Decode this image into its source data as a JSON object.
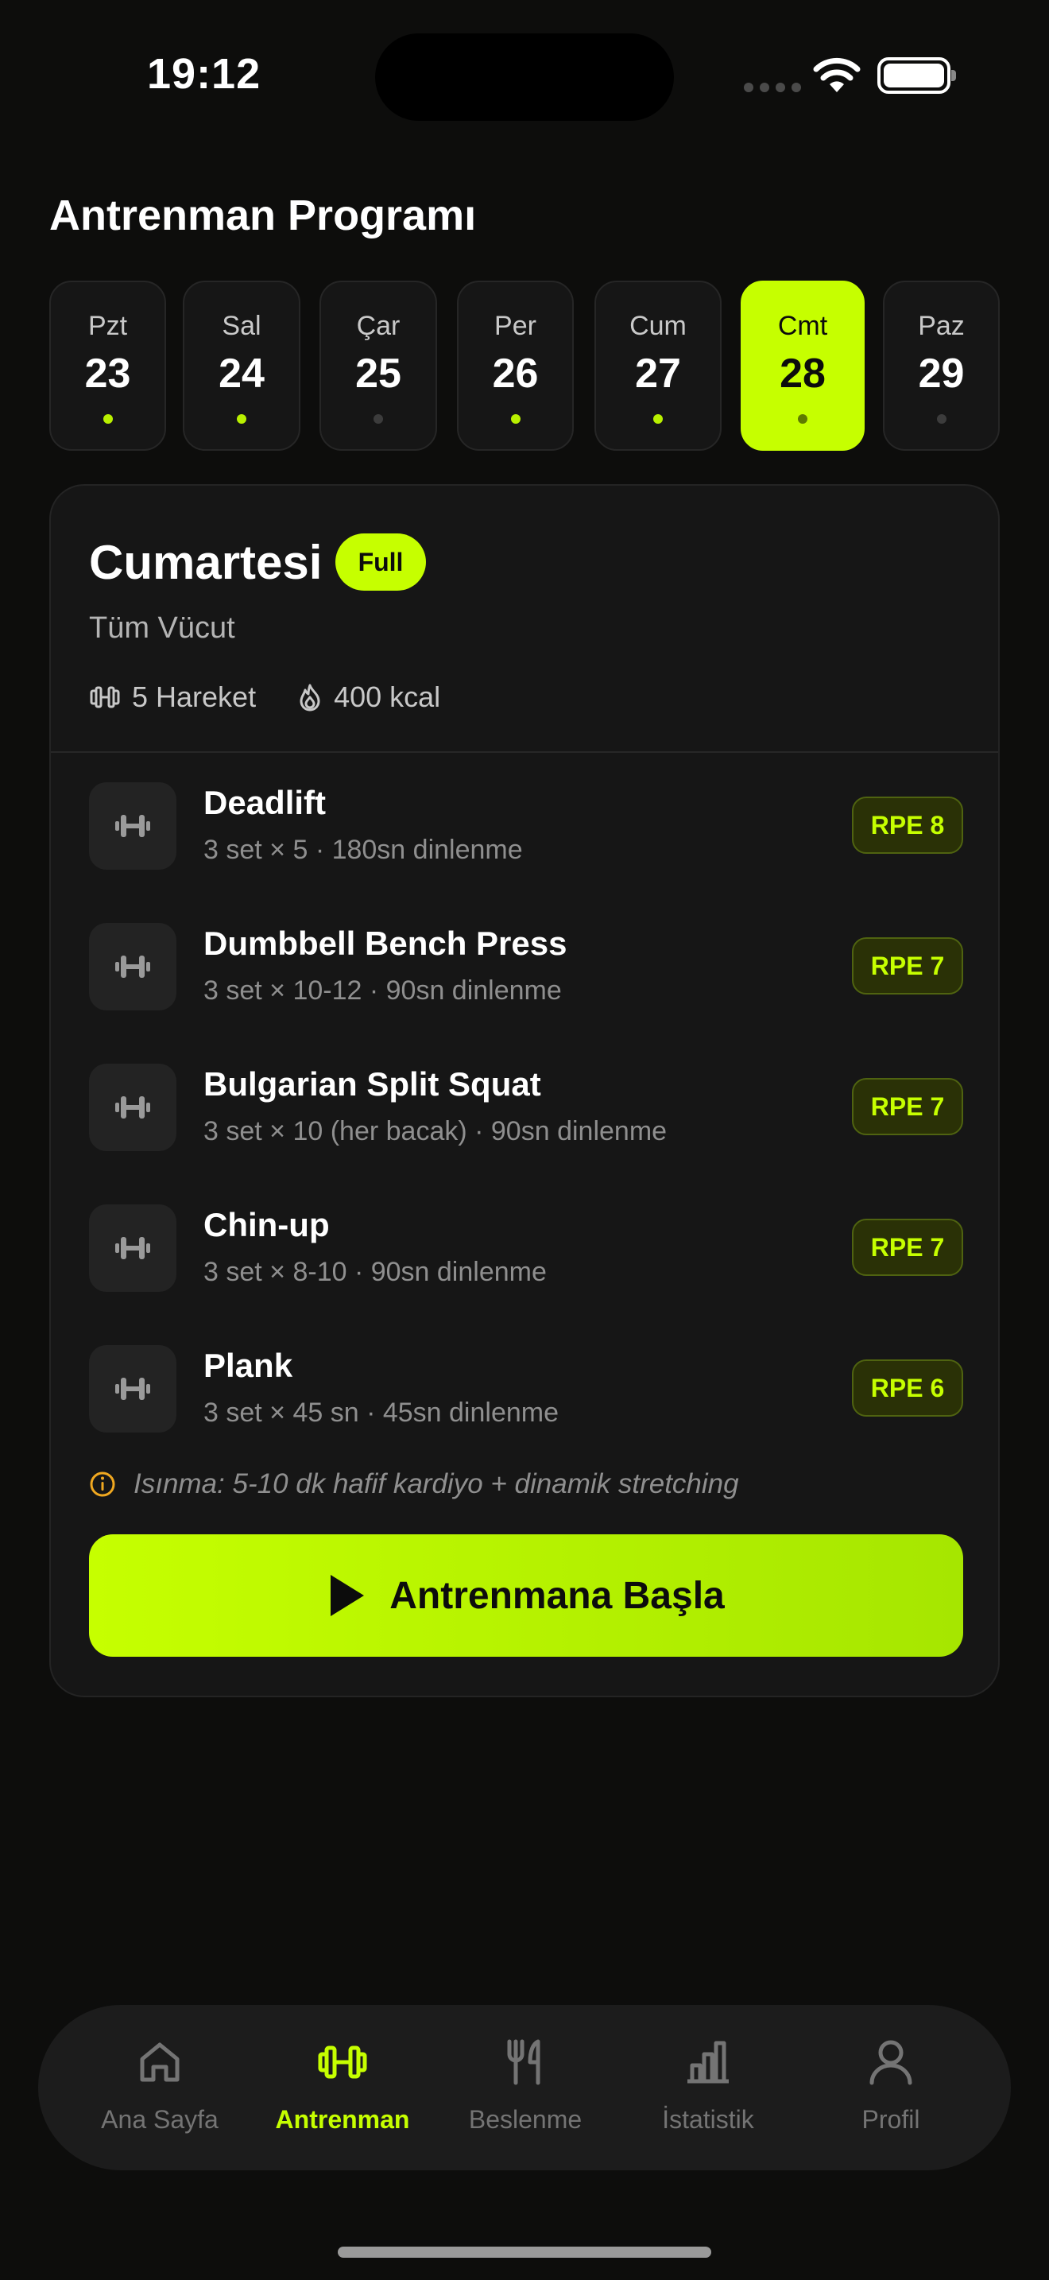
{
  "status_bar": {
    "time": "19:12"
  },
  "page": {
    "title": "Antrenman Programı"
  },
  "days": [
    {
      "name": "Pzt",
      "date": "23",
      "has_workout": true,
      "selected": false
    },
    {
      "name": "Sal",
      "date": "24",
      "has_workout": true,
      "selected": false
    },
    {
      "name": "Çar",
      "date": "25",
      "has_workout": false,
      "selected": false
    },
    {
      "name": "Per",
      "date": "26",
      "has_workout": true,
      "selected": false
    },
    {
      "name": "Cum",
      "date": "27",
      "has_workout": true,
      "selected": false
    },
    {
      "name": "Cmt",
      "date": "28",
      "has_workout": false,
      "selected": true
    },
    {
      "name": "Paz",
      "date": "29",
      "has_workout": false,
      "selected": false
    }
  ],
  "workout": {
    "day": "Cumartesi",
    "type_badge": "Full",
    "subtitle": "Tüm Vücut",
    "exercise_count": "5 Hareket",
    "calories": "400 kcal",
    "exercises": [
      {
        "name": "Deadlift",
        "detail": "3 set × 5 · 180sn dinlenme",
        "rpe": "RPE 8"
      },
      {
        "name": "Dumbbell Bench Press",
        "detail": "3 set × 10-12 · 90sn dinlenme",
        "rpe": "RPE 7"
      },
      {
        "name": "Bulgarian Split Squat",
        "detail": "3 set × 10 (her bacak) · 90sn dinlenme",
        "rpe": "RPE 7"
      },
      {
        "name": "Chin-up",
        "detail": "3 set × 8-10 · 90sn dinlenme",
        "rpe": "RPE 7"
      },
      {
        "name": "Plank",
        "detail": "3 set × 45 sn · 45sn dinlenme",
        "rpe": "RPE 6"
      }
    ],
    "warmup_note": "Isınma: 5-10 dk hafif kardiyo + dinamik stretching",
    "start_label": "Antrenmana Başla"
  },
  "nav": {
    "items": [
      {
        "label": "Ana Sayfa",
        "icon": "home-icon",
        "active": false
      },
      {
        "label": "Antrenman",
        "icon": "dumbbell-icon",
        "active": true
      },
      {
        "label": "Beslenme",
        "icon": "fork-knife-icon",
        "active": false
      },
      {
        "label": "İstatistik",
        "icon": "bar-chart-icon",
        "active": false
      },
      {
        "label": "Profil",
        "icon": "user-icon",
        "active": false
      }
    ]
  },
  "colors": {
    "accent": "#c6ff00",
    "background": "#0d0d0c",
    "card": "#161616"
  }
}
